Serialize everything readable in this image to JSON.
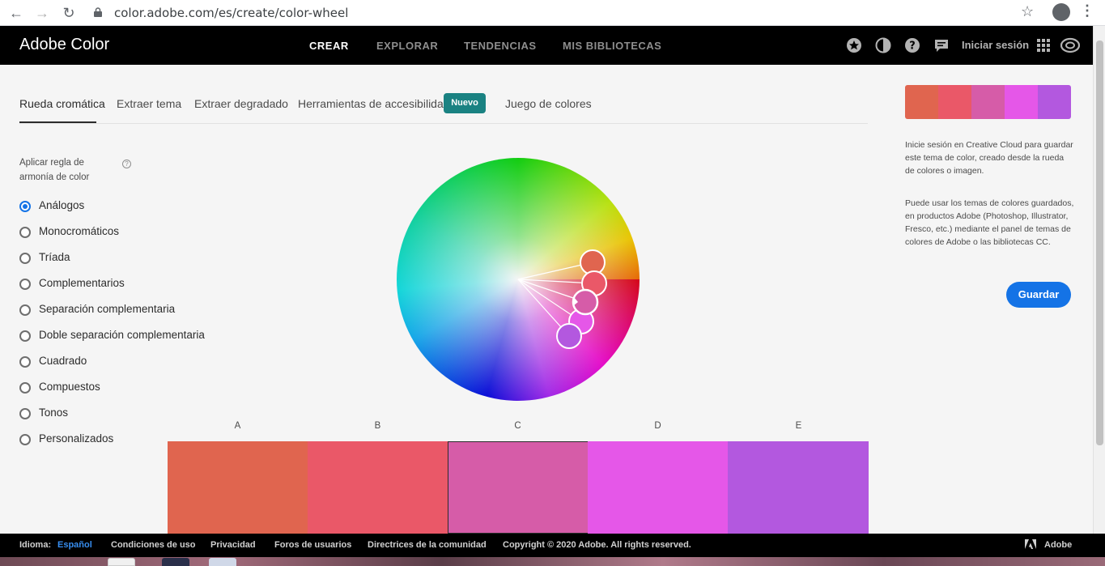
{
  "browser": {
    "url": "color.adobe.com/es/create/color-wheel"
  },
  "app": {
    "brand": "Adobe Color",
    "nav": [
      "CREAR",
      "EXPLORAR",
      "TENDENCIAS",
      "MIS BIBLIOTECAS"
    ],
    "signin": "Iniciar sesión"
  },
  "tabs": {
    "items": [
      "Rueda cromática",
      "Extraer tema",
      "Extraer degradado",
      "Herramientas de accesibilidad",
      "Juego de colores"
    ],
    "badge": "Nuevo"
  },
  "harmony": {
    "label": "Aplicar regla de armonía de color",
    "help": "?",
    "rules": [
      "Análogos",
      "Monocromáticos",
      "Tríada",
      "Complementarios",
      "Separación complementaria",
      "Doble separación complementaria",
      "Cuadrado",
      "Compuestos",
      "Tonos",
      "Personalizados"
    ],
    "selected": "Análogos"
  },
  "swatches": {
    "letters": [
      "A",
      "B",
      "C",
      "D",
      "E"
    ],
    "colors": [
      "#e0654f",
      "#ea5868",
      "#d65ca8",
      "#e557e8",
      "#b358df"
    ],
    "selected": "C"
  },
  "panel": {
    "info1": "Inicie sesión en Creative Cloud para guardar este tema de color, creado desde la rueda de colores o imagen.",
    "info2": "Puede usar los temas de colores guardados, en productos Adobe (Photoshop, Illustrator, Fresco, etc.) mediante el panel de temas de colores de Adobe o las bibliotecas CC.",
    "save": "Guardar"
  },
  "footer": {
    "lang_label": "Idioma:",
    "lang_value": "Español",
    "links": [
      "Condiciones de uso",
      "Privacidad",
      "Foros de usuarios",
      "Directrices de la comunidad"
    ],
    "copyright": "Copyright © 2020 Adobe. All rights reserved.",
    "adobe": "Adobe"
  },
  "icons": [
    "back-arrow-icon",
    "forward-arrow-icon",
    "reload-icon",
    "lock-icon",
    "star-icon",
    "account-icon",
    "more-menu-icon",
    "badge-star-icon",
    "theme-contrast-icon",
    "help-icon",
    "chat-icon",
    "apps-grid-icon",
    "creative-cloud-icon",
    "adobe-logo-icon"
  ]
}
